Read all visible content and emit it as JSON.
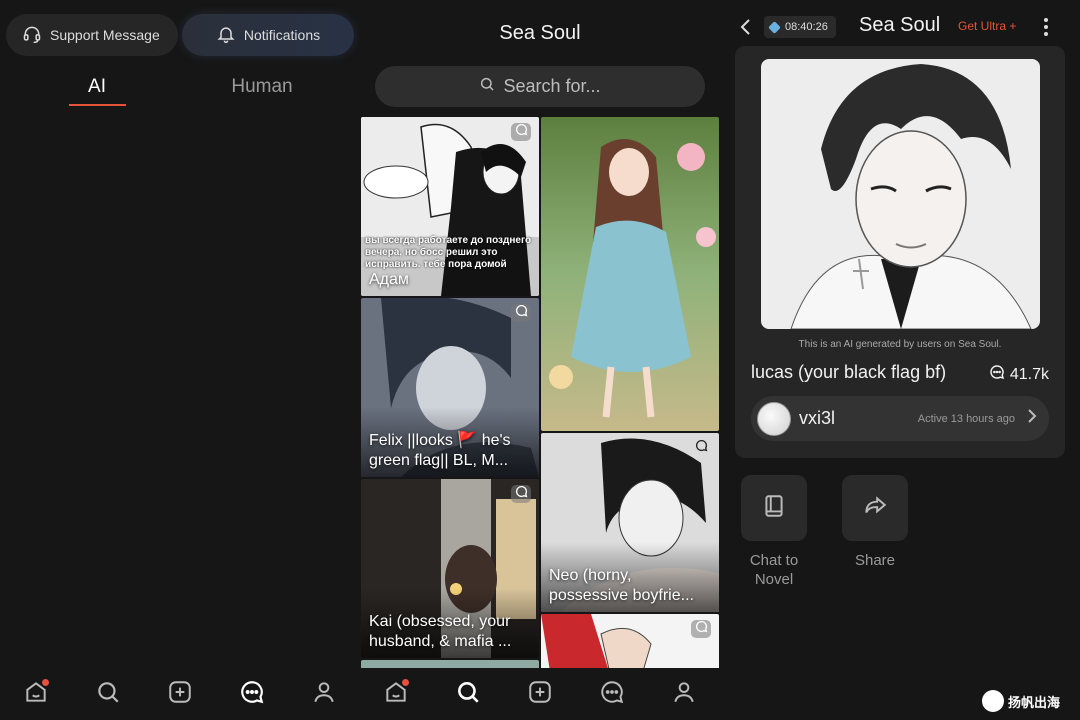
{
  "left_panel": {
    "support_label": "Support Message",
    "notifications_label": "Notifications",
    "tabs": [
      {
        "label": "AI",
        "active": true
      },
      {
        "label": "Human",
        "active": false
      }
    ],
    "bottom_nav": [
      "home-icon",
      "search-icon",
      "add-icon",
      "chat-icon",
      "profile-icon"
    ]
  },
  "middle_panel": {
    "app_title": "Sea Soul",
    "search_placeholder": "Search for...",
    "cards": [
      {
        "caption": "Адам",
        "overlay_text": "вы всегда работаете до позднего вечера, но босс решил это исправить. тебе пора домой"
      },
      {
        "caption": ""
      },
      {
        "caption": "Felix ||looks 🚩 he's green flag|| BL, M..."
      },
      {
        "caption": "Neo (horny, possessive boyfrie..."
      },
      {
        "caption": "Kai (obsessed, your husband, & mafia ..."
      },
      {
        "caption": ""
      },
      {
        "caption": ""
      }
    ],
    "bottom_nav": [
      "home-icon",
      "search-icon",
      "add-icon",
      "chat-icon",
      "profile-icon"
    ]
  },
  "right_panel": {
    "time": "08:40:26",
    "app_title": "Sea Soul",
    "ultra_label": "Get Ultra +",
    "ai_note": "This is an AI generated by users on Sea Soul.",
    "character_name": "lucas (your black flag bf)",
    "chat_count": "41.7k",
    "creator_name": "vxi3l",
    "creator_active": "Active 13 hours ago",
    "actions": [
      {
        "label": "Chat to Novel",
        "icon": "book-icon"
      },
      {
        "label": "Share",
        "icon": "share-icon"
      }
    ],
    "watermark": "扬帆出海"
  },
  "colors": {
    "accent": "#e5533a",
    "background": "#161616",
    "card": "#262626"
  }
}
